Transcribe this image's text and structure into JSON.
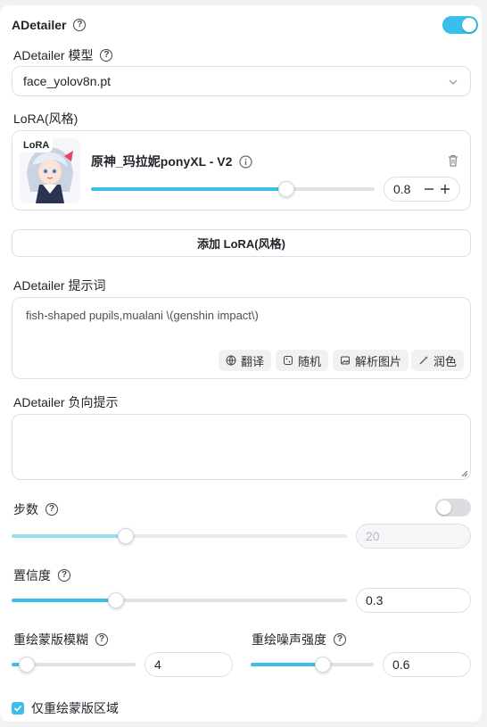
{
  "header": {
    "title": "ADetailer",
    "enabled": true
  },
  "model": {
    "label": "ADetailer 模型",
    "value": "face_yolov8n.pt"
  },
  "lora": {
    "section_label": "LoRA(风格)",
    "badge": "LoRA",
    "card_title": "原神_玛拉妮ponyXL - V2",
    "weight_value": "0.8",
    "weight_fraction": 0.69,
    "add_button": "添加 LoRA(风格)"
  },
  "prompt": {
    "label": "ADetailer 提示词",
    "value": "fish-shaped pupils,mualani \\(genshin impact\\)",
    "actions": [
      "翻译",
      "随机",
      "解析图片",
      "润色"
    ]
  },
  "negative_prompt": {
    "label": "ADetailer 负向提示",
    "value": ""
  },
  "steps": {
    "label": "步数",
    "enabled": false,
    "value": "20",
    "fraction": 0.34
  },
  "confidence": {
    "label": "置信度",
    "value": "0.3",
    "fraction": 0.31
  },
  "mask_blur": {
    "label": "重绘蒙版模糊",
    "value": "4",
    "fraction": 0.12
  },
  "denoise": {
    "label": "重绘噪声强度",
    "value": "0.6",
    "fraction": 0.59
  },
  "inpaint_only": {
    "label": "仅重绘蒙版区域",
    "checked": true
  },
  "colors": {
    "accent": "#39bfe9",
    "track": "#dfe1e5",
    "border": "#dcdfe4"
  }
}
